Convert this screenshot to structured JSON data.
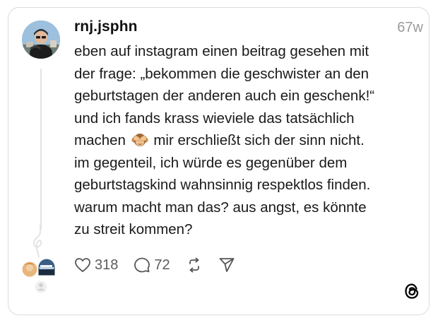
{
  "post": {
    "username": "rnj.jsphn",
    "timestamp": "67w",
    "lines": [
      "eben auf instagram einen beitrag gesehen mit",
      "der frage: „bekommen die geschwister an den",
      "geburtstagen der anderen auch ein geschenk!“",
      "und ich fands krass wieviele das tatsächlich",
      "mir erschließt sich der sinn nicht.",
      "im gegenteil, ich würde es gegenüber dem",
      "geburtstagskind wahnsinnig respektlos finden.",
      "warum macht man das? aus angst, es könnte",
      "zu streit kommen?"
    ],
    "line5_prefix": "machen",
    "emoji_name": "see-no-evil-monkey-icon"
  },
  "actions": {
    "likes": "318",
    "replies": "72",
    "like_icon": "heart-icon",
    "reply_icon": "speech-bubble-icon",
    "repost_icon": "repost-icon",
    "share_icon": "send-icon"
  },
  "brand": {
    "logo": "threads-logo-icon",
    "border_color": "#dcdcdc",
    "muted_color": "#9a9a9a"
  }
}
